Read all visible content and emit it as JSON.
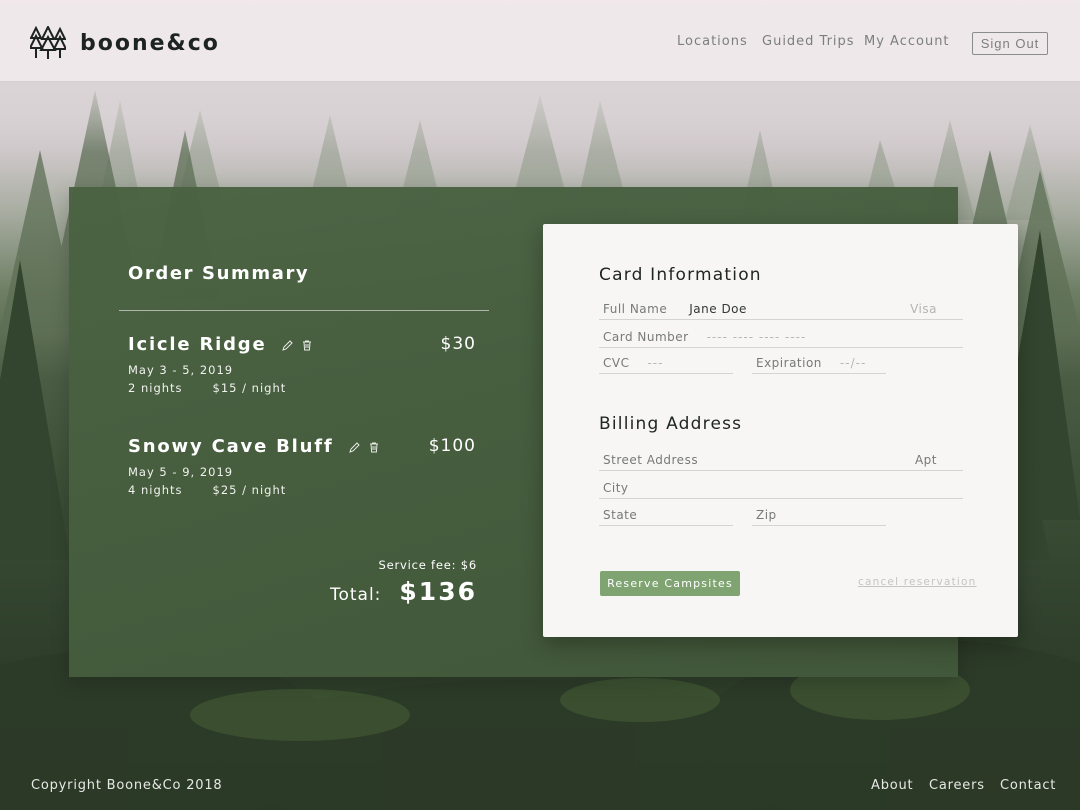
{
  "brand": {
    "name": "boone&co",
    "logo_icon": "pine-trees-icon"
  },
  "nav": {
    "items": [
      {
        "label": "Locations"
      },
      {
        "label": "Guided Trips"
      },
      {
        "label": "My Account"
      }
    ],
    "sign_out": "Sign Out"
  },
  "order_summary": {
    "title": "Order Summary",
    "items": [
      {
        "name": "Icicle Ridge",
        "price": "$30",
        "dates": "May 3 - 5, 2019",
        "nights": "2 nights",
        "rate": "$15 / night",
        "edit_icon": "pencil-icon",
        "delete_icon": "trash-icon"
      },
      {
        "name": "Snowy Cave Bluff",
        "price": "$100",
        "dates": "May 5 - 9, 2019",
        "nights": "4 nights",
        "rate": "$25 / night",
        "edit_icon": "pencil-icon",
        "delete_icon": "trash-icon"
      }
    ],
    "service_fee": "Service fee:  $6",
    "total_label": "Total:",
    "total_value": "$136"
  },
  "card_info": {
    "title": "Card Information",
    "full_name_label": "Full Name",
    "full_name_value": "Jane Doe",
    "card_type": "Visa",
    "card_number_label": "Card Number",
    "card_number_placeholder": "---- ---- ---- ----",
    "cvc_label": "CVC",
    "cvc_placeholder": "---",
    "expiration_label": "Expiration",
    "expiration_placeholder": "--/--"
  },
  "billing": {
    "title": "Billing Address",
    "street_label": "Street Address",
    "apt_label": "Apt",
    "city_label": "City",
    "state_label": "State",
    "zip_label": "Zip"
  },
  "actions": {
    "reserve": "Reserve Campsites",
    "cancel": "cancel reservation"
  },
  "footer": {
    "copyright": "Copyright Boone&Co 2018",
    "links": [
      {
        "label": "About"
      },
      {
        "label": "Careers"
      },
      {
        "label": "Contact"
      }
    ]
  },
  "colors": {
    "panel_green": "#4a6242",
    "button_green": "#7fa472",
    "header_bg": "#efe8eb"
  }
}
